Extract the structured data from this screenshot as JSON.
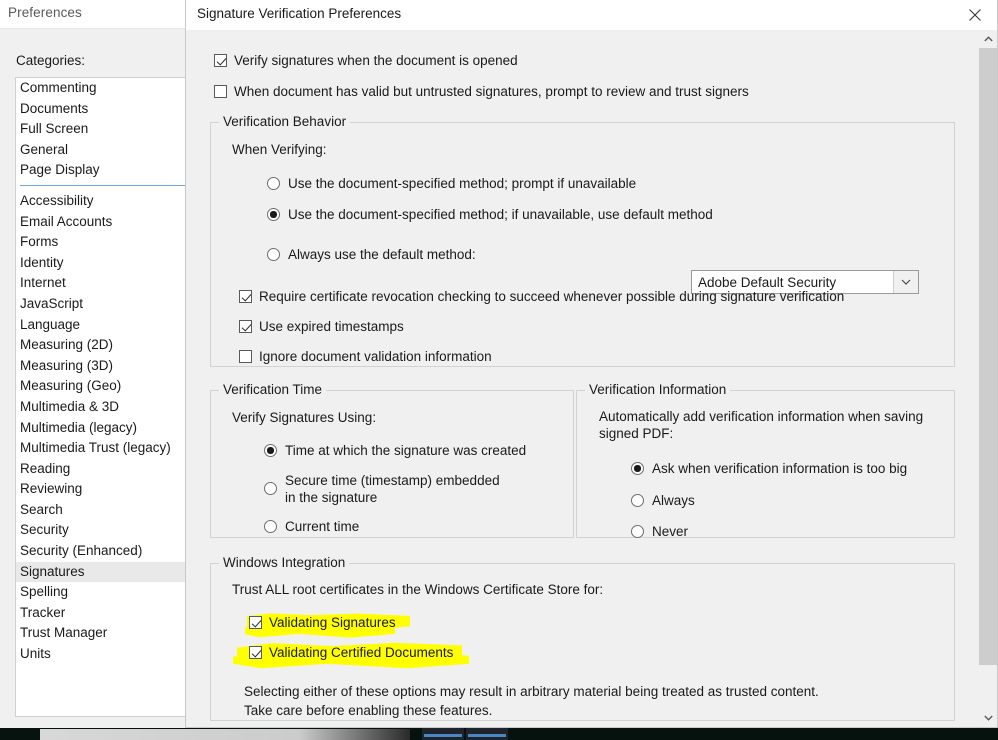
{
  "prefs_window": {
    "title": "Preferences",
    "categories_label": "Categories:",
    "categories_group1": [
      "Commenting",
      "Documents",
      "Full Screen",
      "General",
      "Page Display"
    ],
    "categories_group2": [
      "Accessibility",
      "Email Accounts",
      "Forms",
      "Identity",
      "Internet",
      "JavaScript",
      "Language",
      "Measuring (2D)",
      "Measuring (3D)",
      "Measuring (Geo)",
      "Multimedia & 3D",
      "Multimedia (legacy)",
      "Multimedia Trust (legacy)",
      "Reading",
      "Reviewing",
      "Search",
      "Security",
      "Security (Enhanced)",
      "Signatures",
      "Spelling",
      "Tracker",
      "Trust Manager",
      "Units"
    ],
    "selected_category": "Signatures"
  },
  "dialog": {
    "title": "Signature Verification Preferences",
    "close_label": "Close",
    "top_checkboxes": [
      {
        "label": "Verify signatures when the document is opened",
        "checked": true
      },
      {
        "label": "When document has valid but untrusted signatures, prompt to review and trust signers",
        "checked": false
      }
    ],
    "verification_behavior": {
      "title": "Verification Behavior",
      "when_verifying_label": "When Verifying:",
      "radios": [
        {
          "label": "Use the document-specified method; prompt if unavailable",
          "selected": false
        },
        {
          "label": "Use the document-specified method; if unavailable, use default method",
          "selected": true
        },
        {
          "label": "Always use the default method:",
          "selected": false
        }
      ],
      "default_method_value": "Adobe Default Security",
      "default_method_options": [
        "Adobe Default Security"
      ],
      "checkboxes": [
        {
          "label": "Require certificate revocation checking to succeed whenever possible during signature verification",
          "checked": true
        },
        {
          "label": "Use expired timestamps",
          "checked": true
        },
        {
          "label": "Ignore document validation information",
          "checked": false
        }
      ]
    },
    "verification_time": {
      "title": "Verification Time",
      "sub_label": "Verify Signatures Using:",
      "radios": [
        {
          "label": "Time at which the signature was created",
          "selected": true
        },
        {
          "label": "Secure time (timestamp) embedded\nin the signature",
          "selected": false
        },
        {
          "label": "Current time",
          "selected": false
        }
      ]
    },
    "verification_information": {
      "title": "Verification Information",
      "sub_label": "Automatically add verification information when saving\nsigned PDF:",
      "radios": [
        {
          "label": "Ask when verification information is too big",
          "selected": true
        },
        {
          "label": "Always",
          "selected": false
        },
        {
          "label": "Never",
          "selected": false
        }
      ]
    },
    "windows_integration": {
      "title": "Windows Integration",
      "sub_label": "Trust ALL root certificates in the Windows Certificate Store for:",
      "checkboxes": [
        {
          "label": "Validating Signatures",
          "checked": true,
          "highlighted": true
        },
        {
          "label": "Validating Certified Documents",
          "checked": true,
          "highlighted": true
        }
      ],
      "warning_line1": "Selecting either of these options may result in arbitrary material being treated as trusted content.",
      "warning_line2": "Take care before enabling these features."
    }
  },
  "colors": {
    "highlight": "#ffff00",
    "dialog_bg": "#f0f0f0",
    "selected_row": "#e9e9e9",
    "separator": "#6fa8dc"
  }
}
